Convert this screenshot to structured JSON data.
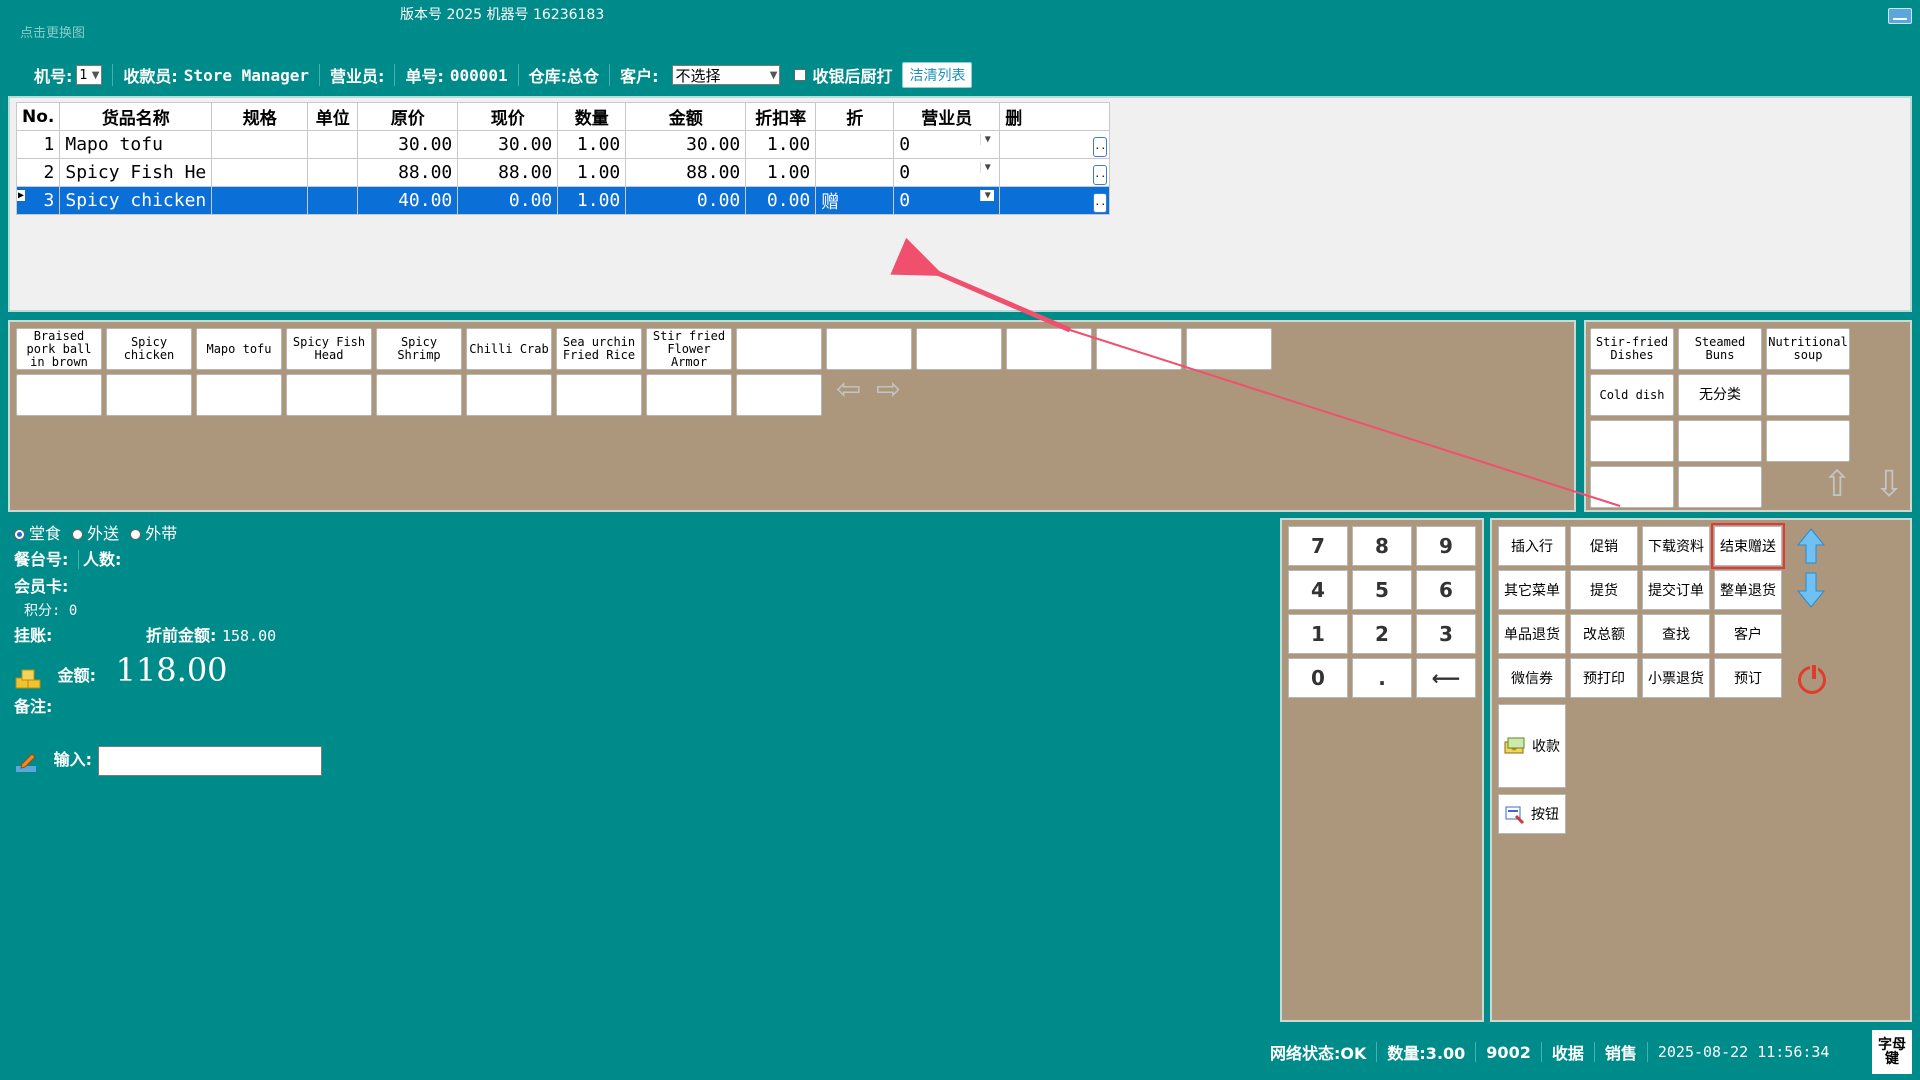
{
  "titlebar": {
    "logo_text": "点击更换图",
    "version_text": "版本号  2025  机器号  16236183"
  },
  "infobar": {
    "machine_label": "机号:",
    "machine_value": "1",
    "cashier_label": "收款员:",
    "cashier_value": "Store Manager",
    "salesperson_label": "营业员:",
    "order_label": "单号:",
    "order_value": "000001",
    "warehouse_label": "仓库:",
    "warehouse_value": "总仓",
    "customer_label": "客户:",
    "customer_value": "不选择",
    "kitchen_print_label": "收银后厨打",
    "clear_list_label": "洁清列表"
  },
  "grid": {
    "columns": [
      "No.",
      "货品名称",
      "规格",
      "单位",
      "原价",
      "现价",
      "数量",
      "金额",
      "折扣率",
      "折",
      "营业员",
      "删"
    ],
    "rows": [
      {
        "no": "1",
        "name": "Mapo tofu",
        "spec": "",
        "unit": "",
        "orig": "30.00",
        "price": "30.00",
        "qty": "1.00",
        "amount": "30.00",
        "rate": "1.00",
        "zhe": "",
        "staff": "0",
        "del": ".."
      },
      {
        "no": "2",
        "name": "Spicy Fish He",
        "spec": "",
        "unit": "",
        "orig": "88.00",
        "price": "88.00",
        "qty": "1.00",
        "amount": "88.00",
        "rate": "1.00",
        "zhe": "",
        "staff": "0",
        "del": ".."
      },
      {
        "no": "3",
        "name": "Spicy chicken",
        "spec": "",
        "unit": "",
        "orig": "40.00",
        "price": "0.00",
        "qty": "1.00",
        "amount": "0.00",
        "rate": "0.00",
        "zhe": "赠",
        "staff": "0",
        "del": ".."
      }
    ],
    "selected_row": 3
  },
  "dishes": [
    "Braised pork ball in brown",
    "Spicy chicken",
    "Mapo tofu",
    "Spicy Fish Head",
    "Spicy Shrimp",
    "Chilli Crab",
    "Sea urchin Fried Rice",
    "Stir fried Flower Armor"
  ],
  "categories": [
    "Stir-fried Dishes",
    "Steamed Buns",
    "Nutritional soup",
    "Cold dish",
    "无分类"
  ],
  "order_type": {
    "options": [
      "堂食",
      "外送",
      "外带"
    ],
    "selected": "堂食"
  },
  "left_info": {
    "table_label": "餐台号:",
    "people_label": "人数:",
    "member_label": "会员卡:",
    "points_label": "积分:",
    "points_value": "0",
    "account_label": "挂账:",
    "pre_discount_label": "折前金额:",
    "pre_discount_value": "158.00",
    "amount_label": "金额:",
    "amount_value": "118.00",
    "note_label": "备注:",
    "input_label": "输入:"
  },
  "keypad": [
    "7",
    "8",
    "9",
    "4",
    "5",
    "6",
    "1",
    "2",
    "3",
    "0",
    ".",
    "⟵"
  ],
  "functions": {
    "row1": [
      "插入行",
      "促销",
      "下载资料",
      "结束赠送"
    ],
    "row2": [
      "其它菜单",
      "提货",
      "提交订单",
      "整单退货"
    ],
    "row3": [
      "单品退货",
      "改总额",
      "查找",
      "客户"
    ],
    "row4": [
      "微信券",
      "预打印",
      "小票退货",
      "预订"
    ],
    "checkout": "收款",
    "buttons": "按钮",
    "highlighted": "结束赠送"
  },
  "status": {
    "network": "网络状态:OK",
    "quantity": "数量:3.00",
    "code": "9002",
    "mode1": "收据",
    "mode2": "销售",
    "datetime": "2025-08-22 11:56:34",
    "ime": "字母 键"
  },
  "colors": {
    "background": "#008b8b",
    "panel": "#ad977c",
    "selection": "#0a6fd6",
    "annotation": "#f0506e"
  }
}
